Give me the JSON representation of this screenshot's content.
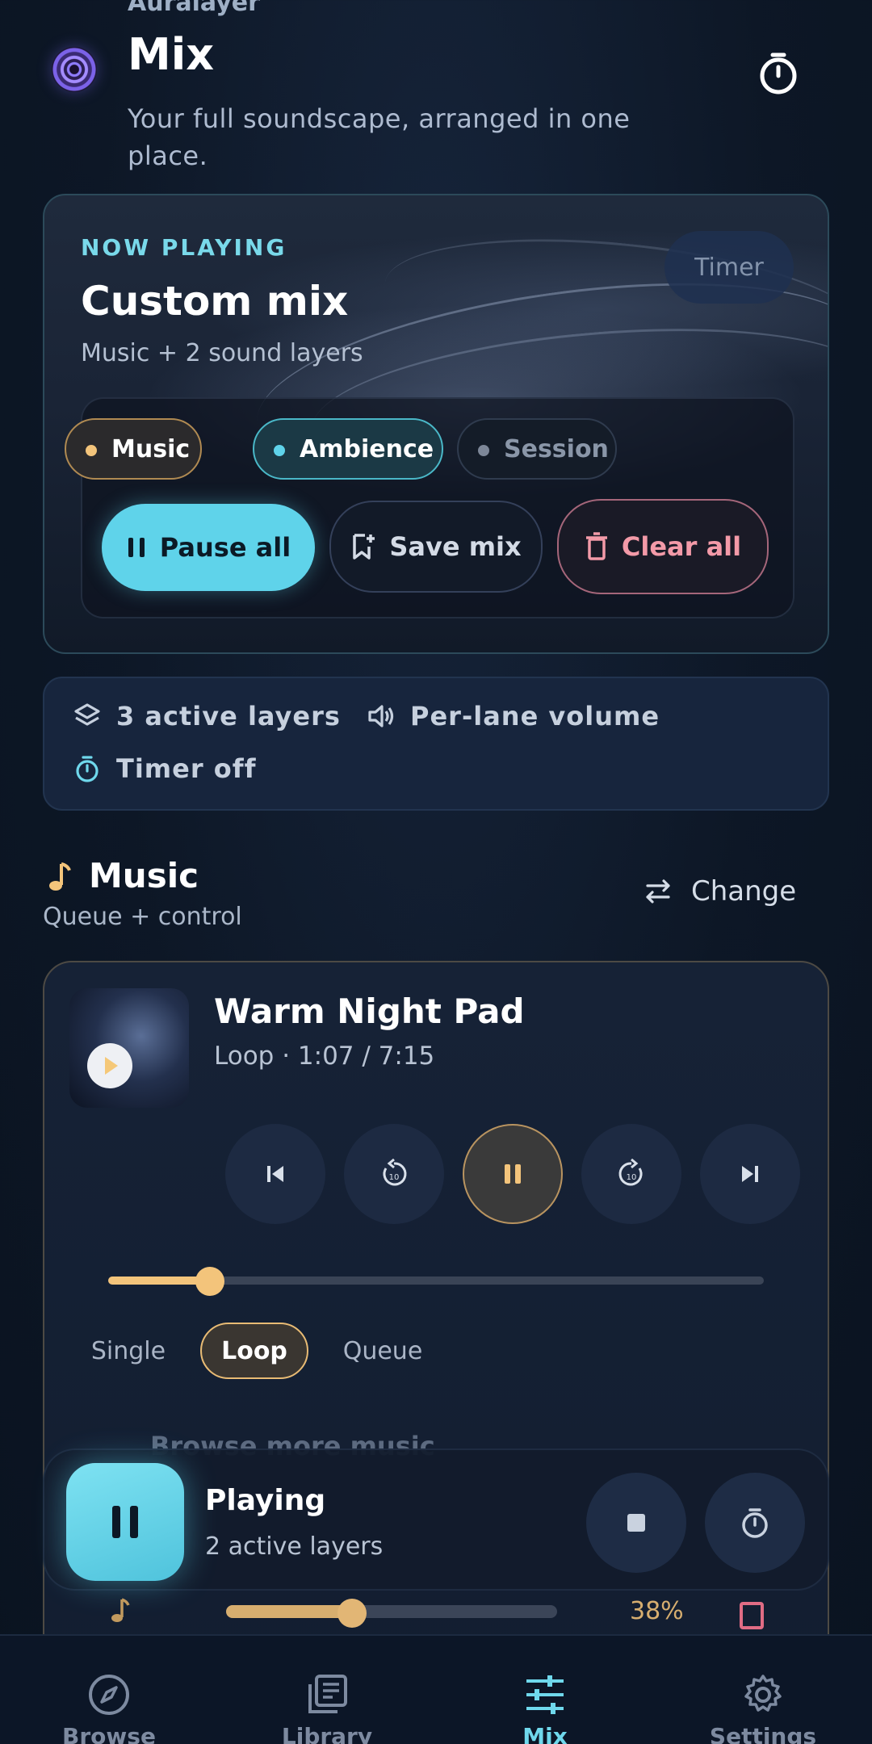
{
  "header": {
    "app_name": "Auralayer",
    "title": "Mix",
    "subtitle": "Your full soundscape, arranged in one place."
  },
  "hero": {
    "eyebrow": "NOW PLAYING",
    "title": "Custom mix",
    "subtitle": "Music + 2 sound layers",
    "timer_label": "Timer",
    "chips": [
      {
        "label": "Music",
        "color": "#f3c47b"
      },
      {
        "label": "Ambience",
        "color": "#5fd3ea"
      },
      {
        "label": "Session",
        "color": "#7d8798"
      }
    ],
    "buttons": {
      "pause_all": "Pause all",
      "save_mix": "Save mix",
      "clear_all": "Clear all"
    }
  },
  "stats": {
    "layers": "3 active layers",
    "volume": "Per-lane volume",
    "timer": "Timer off"
  },
  "music": {
    "section_title": "Music",
    "section_sub": "Queue + control",
    "change_label": "Change",
    "track_title": "Warm Night Pad",
    "track_meta": "Loop · 1:07 / 7:15",
    "progress": 0.155,
    "modes": [
      "Single",
      "Loop",
      "Queue"
    ],
    "active_mode": "Loop",
    "browse_more": "Browse more music"
  },
  "mini_player": {
    "title": "Playing",
    "subtitle": "2 active layers"
  },
  "volume_row": {
    "percent_label": "38%",
    "level": 0.38
  },
  "nav": {
    "items": [
      {
        "label": "Browse",
        "icon": "compass-icon"
      },
      {
        "label": "Library",
        "icon": "library-icon"
      },
      {
        "label": "Mix",
        "icon": "sliders-icon"
      },
      {
        "label": "Settings",
        "icon": "gear-icon"
      }
    ],
    "active": "Mix"
  },
  "colors": {
    "accent_cyan": "#5fd3ea",
    "accent_gold": "#f3c47b",
    "danger": "#f39aa8"
  }
}
